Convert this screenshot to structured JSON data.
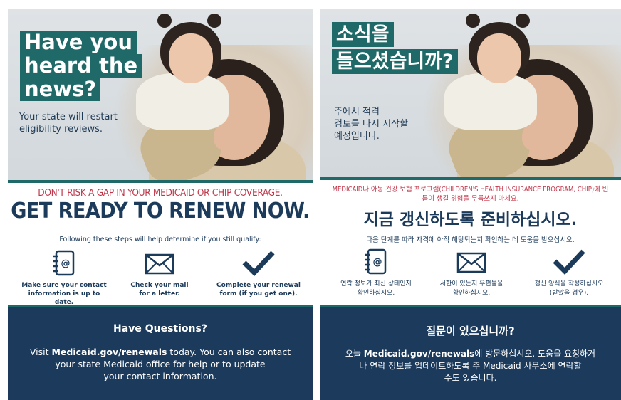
{
  "colors": {
    "teal": "#1f6a68",
    "navy": "#1b3a5c",
    "red": "#c0374a",
    "dark_text": "#1c3a5a"
  },
  "english": {
    "headline_lines": [
      "Have you",
      "heard the",
      "news?"
    ],
    "subhead_lines": [
      "Your state will restart",
      "eligibility reviews."
    ],
    "warning": "DON'T RISK A GAP IN YOUR MEDICAID OR CHIP COVERAGE.",
    "call_to_action": "GET READY TO RENEW NOW.",
    "steps_intro": "Following these steps will help determine if you still qualify:",
    "steps": [
      {
        "icon": "address-book-icon",
        "line1": "Make sure your contact",
        "line2": "information is up to date."
      },
      {
        "icon": "envelope-icon",
        "line1": "Check your mail",
        "line2": "for a letter."
      },
      {
        "icon": "checkmark-icon",
        "line1": "Complete your renewal",
        "line2": "form (if you get one)."
      }
    ],
    "questions_title": "Have Questions?",
    "questions_link": "Medicaid.gov/renewals",
    "questions_prefix": "Visit ",
    "questions_line1_suffix": " today. You can also contact",
    "questions_line2": "your state Medicaid office for help or to update",
    "questions_line3": "your contact information."
  },
  "korean": {
    "headline_lines": [
      "소식을",
      "들으셨습니까?"
    ],
    "subhead_lines": [
      "주에서 적격",
      "검토를 다시 시작할",
      "예정입니다."
    ],
    "warning_line1": "MEDICAID나 아동 건강 보험 프로그램(CHILDREN'S HEALTH INSURANCE PROGRAM, CHIP)에 빈",
    "warning_line2": "틈이 생길 위험을 무릅쓰지 마세요.",
    "call_to_action": "지금 갱신하도록 준비하십시오.",
    "steps_intro": "다음 단계를 따라 자격에 아직 해당되는지 확인하는 데 도움을 받으십시오.",
    "steps": [
      {
        "icon": "address-book-icon",
        "line1": "연락 정보가 최신 상태인지",
        "line2": "확인하십시오."
      },
      {
        "icon": "envelope-icon",
        "line1": "서한이 있는지 우편물을",
        "line2": "확인하십시오."
      },
      {
        "icon": "checkmark-icon",
        "line1": "갱신 양식을 작성하십시오",
        "line2": "(받았을 경우)."
      }
    ],
    "questions_title": "질문이 있으십니까?",
    "questions_prefix": "오늘 ",
    "questions_link": "Medicaid.gov/renewals",
    "questions_line1_suffix": "에 방문하십시오. 도움을 요청하거",
    "questions_line2": "나 연락 정보를 업데이트하도록 주 Medicaid 사무소에 연락할",
    "questions_line3": "수도 있습니다."
  }
}
